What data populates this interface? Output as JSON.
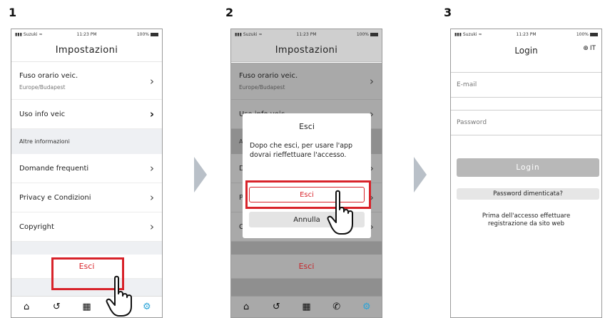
{
  "steps": [
    "1",
    "2",
    "3"
  ],
  "status": {
    "carrier": "Suzuki",
    "time": "11:23 PM",
    "battery": "100%"
  },
  "settings": {
    "title": "Impostazioni",
    "timezone_label": "Fuso orario veic.",
    "timezone_value": "Europe/Budapest",
    "vehicle_info": "Uso info veic",
    "section_other": "Altre informazioni",
    "faq": "Domande frequenti",
    "privacy": "Privacy e Condizioni",
    "copyright": "Copyright",
    "logout": "Esci"
  },
  "dialog": {
    "title": "Esci",
    "message": "Dopo che esci, per usare l'app dovrai rieffettuare l'accesso.",
    "confirm": "Esci",
    "cancel": "Annulla"
  },
  "login": {
    "title": "Login",
    "language": "IT",
    "email_placeholder": "E-mail",
    "password_placeholder": "Password",
    "login_button": "Login",
    "forgot_password": "Password dimenticata?",
    "register_note": "Prima dell'accesso effettuare registrazione da sito web"
  },
  "tabs": [
    "home-icon",
    "history-icon",
    "map-icon",
    "phone-icon",
    "gear-icon"
  ],
  "colors": {
    "accent_red": "#d8232a",
    "tab_active": "#2aa4d8",
    "section_bg": "#eef0f3",
    "login_button_bg": "#b8b8b8"
  }
}
